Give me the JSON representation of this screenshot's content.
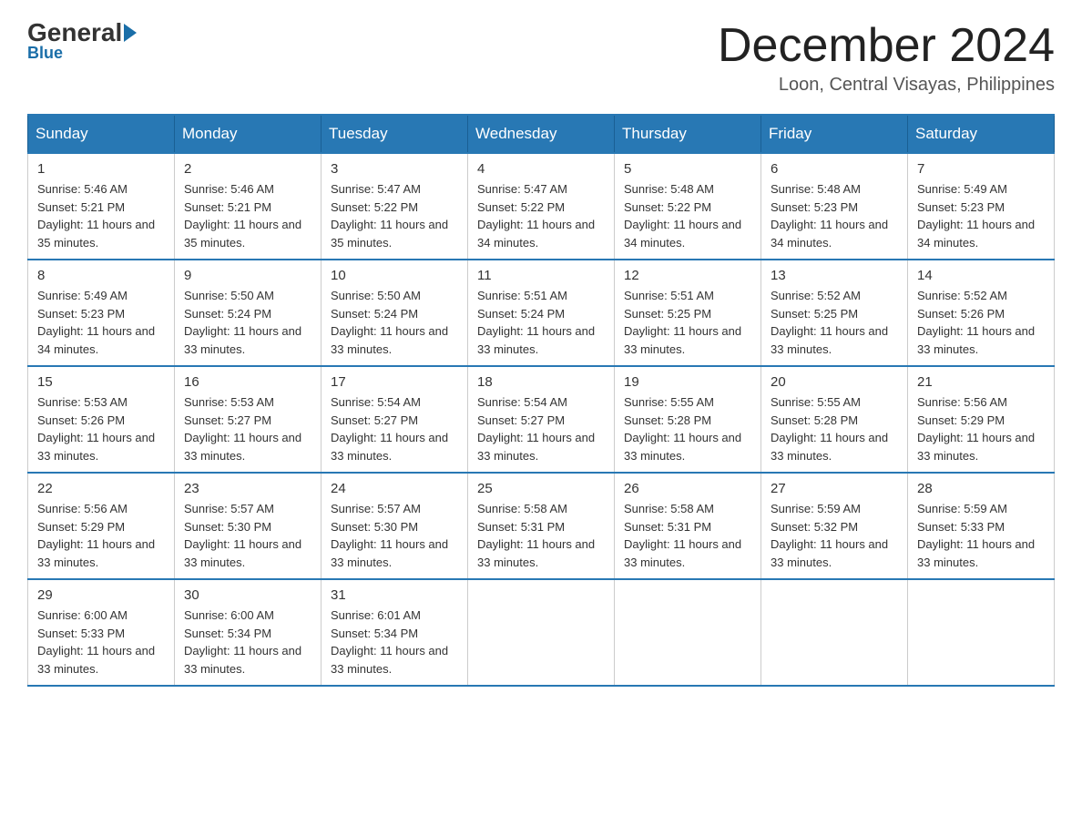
{
  "logo": {
    "general": "General",
    "blue": "Blue"
  },
  "title": "December 2024",
  "location": "Loon, Central Visayas, Philippines",
  "days_of_week": [
    "Sunday",
    "Monday",
    "Tuesday",
    "Wednesday",
    "Thursday",
    "Friday",
    "Saturday"
  ],
  "weeks": [
    [
      {
        "day": "1",
        "sunrise": "5:46 AM",
        "sunset": "5:21 PM",
        "daylight": "11 hours and 35 minutes."
      },
      {
        "day": "2",
        "sunrise": "5:46 AM",
        "sunset": "5:21 PM",
        "daylight": "11 hours and 35 minutes."
      },
      {
        "day": "3",
        "sunrise": "5:47 AM",
        "sunset": "5:22 PM",
        "daylight": "11 hours and 35 minutes."
      },
      {
        "day": "4",
        "sunrise": "5:47 AM",
        "sunset": "5:22 PM",
        "daylight": "11 hours and 34 minutes."
      },
      {
        "day": "5",
        "sunrise": "5:48 AM",
        "sunset": "5:22 PM",
        "daylight": "11 hours and 34 minutes."
      },
      {
        "day": "6",
        "sunrise": "5:48 AM",
        "sunset": "5:23 PM",
        "daylight": "11 hours and 34 minutes."
      },
      {
        "day": "7",
        "sunrise": "5:49 AM",
        "sunset": "5:23 PM",
        "daylight": "11 hours and 34 minutes."
      }
    ],
    [
      {
        "day": "8",
        "sunrise": "5:49 AM",
        "sunset": "5:23 PM",
        "daylight": "11 hours and 34 minutes."
      },
      {
        "day": "9",
        "sunrise": "5:50 AM",
        "sunset": "5:24 PM",
        "daylight": "11 hours and 33 minutes."
      },
      {
        "day": "10",
        "sunrise": "5:50 AM",
        "sunset": "5:24 PM",
        "daylight": "11 hours and 33 minutes."
      },
      {
        "day": "11",
        "sunrise": "5:51 AM",
        "sunset": "5:24 PM",
        "daylight": "11 hours and 33 minutes."
      },
      {
        "day": "12",
        "sunrise": "5:51 AM",
        "sunset": "5:25 PM",
        "daylight": "11 hours and 33 minutes."
      },
      {
        "day": "13",
        "sunrise": "5:52 AM",
        "sunset": "5:25 PM",
        "daylight": "11 hours and 33 minutes."
      },
      {
        "day": "14",
        "sunrise": "5:52 AM",
        "sunset": "5:26 PM",
        "daylight": "11 hours and 33 minutes."
      }
    ],
    [
      {
        "day": "15",
        "sunrise": "5:53 AM",
        "sunset": "5:26 PM",
        "daylight": "11 hours and 33 minutes."
      },
      {
        "day": "16",
        "sunrise": "5:53 AM",
        "sunset": "5:27 PM",
        "daylight": "11 hours and 33 minutes."
      },
      {
        "day": "17",
        "sunrise": "5:54 AM",
        "sunset": "5:27 PM",
        "daylight": "11 hours and 33 minutes."
      },
      {
        "day": "18",
        "sunrise": "5:54 AM",
        "sunset": "5:27 PM",
        "daylight": "11 hours and 33 minutes."
      },
      {
        "day": "19",
        "sunrise": "5:55 AM",
        "sunset": "5:28 PM",
        "daylight": "11 hours and 33 minutes."
      },
      {
        "day": "20",
        "sunrise": "5:55 AM",
        "sunset": "5:28 PM",
        "daylight": "11 hours and 33 minutes."
      },
      {
        "day": "21",
        "sunrise": "5:56 AM",
        "sunset": "5:29 PM",
        "daylight": "11 hours and 33 minutes."
      }
    ],
    [
      {
        "day": "22",
        "sunrise": "5:56 AM",
        "sunset": "5:29 PM",
        "daylight": "11 hours and 33 minutes."
      },
      {
        "day": "23",
        "sunrise": "5:57 AM",
        "sunset": "5:30 PM",
        "daylight": "11 hours and 33 minutes."
      },
      {
        "day": "24",
        "sunrise": "5:57 AM",
        "sunset": "5:30 PM",
        "daylight": "11 hours and 33 minutes."
      },
      {
        "day": "25",
        "sunrise": "5:58 AM",
        "sunset": "5:31 PM",
        "daylight": "11 hours and 33 minutes."
      },
      {
        "day": "26",
        "sunrise": "5:58 AM",
        "sunset": "5:31 PM",
        "daylight": "11 hours and 33 minutes."
      },
      {
        "day": "27",
        "sunrise": "5:59 AM",
        "sunset": "5:32 PM",
        "daylight": "11 hours and 33 minutes."
      },
      {
        "day": "28",
        "sunrise": "5:59 AM",
        "sunset": "5:33 PM",
        "daylight": "11 hours and 33 minutes."
      }
    ],
    [
      {
        "day": "29",
        "sunrise": "6:00 AM",
        "sunset": "5:33 PM",
        "daylight": "11 hours and 33 minutes."
      },
      {
        "day": "30",
        "sunrise": "6:00 AM",
        "sunset": "5:34 PM",
        "daylight": "11 hours and 33 minutes."
      },
      {
        "day": "31",
        "sunrise": "6:01 AM",
        "sunset": "5:34 PM",
        "daylight": "11 hours and 33 minutes."
      },
      null,
      null,
      null,
      null
    ]
  ]
}
